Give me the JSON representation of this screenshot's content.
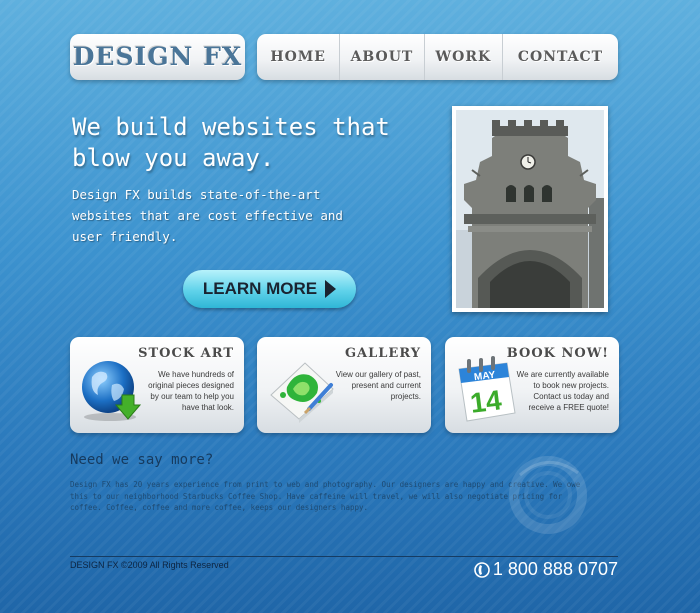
{
  "brand": {
    "logo_text": "DESIGN FX"
  },
  "nav": {
    "items": [
      "HOME",
      "ABOUT",
      "WORK",
      "CONTACT"
    ]
  },
  "hero": {
    "title": "We build websites that blow you away.",
    "description": "Design FX builds state-of-the-art websites that are cost effective and user friendly.",
    "cta_label": "LEARN MORE"
  },
  "features": [
    {
      "title": "STOCK ART",
      "text": "We have hundreds of original pieces designed by our team to help you have that look.",
      "icon": "globe-download-icon"
    },
    {
      "title": "GALLERY",
      "text": "View our gallery of past, present and current projects.",
      "icon": "paint-canvas-icon"
    },
    {
      "title": "BOOK NOW!",
      "text": "We are currently available to book new projects. Contact us today and receive a FREE quote!",
      "icon": "calendar-icon",
      "calendar_month": "MAY",
      "calendar_day": "14"
    }
  ],
  "more": {
    "heading": "Need we say more?",
    "text": "Design FX has 20 years experience from print to web and photography. Our designers are happy and creative. We owe this to our neighborhood Starbucks Coffee Shop. Have caffeine will travel, we will also negotiate pricing for coffee. Coffee, coffee and more coffee, keeps our designers happy."
  },
  "footer": {
    "copyright": "DESIGN FX ©2009 All Rights Reserved",
    "phone": "1 800 888 0707",
    "phone_icon": "phone-icon"
  },
  "colors": {
    "accent": "#5fd2ea",
    "background_top": "#5fb0de",
    "background_bottom": "#1f66a8"
  }
}
